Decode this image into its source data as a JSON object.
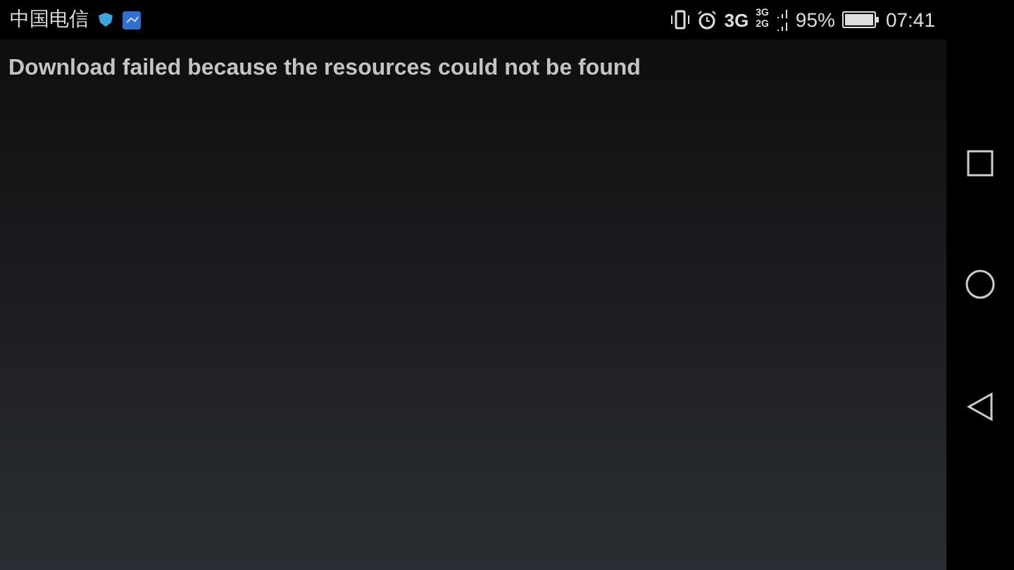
{
  "status_bar": {
    "carrier": "中国电信",
    "network": "3G",
    "sim_networks": [
      "3G",
      "2G"
    ],
    "battery": "95%",
    "time": "07:41"
  },
  "message": "Download failed because the resources could not be found"
}
